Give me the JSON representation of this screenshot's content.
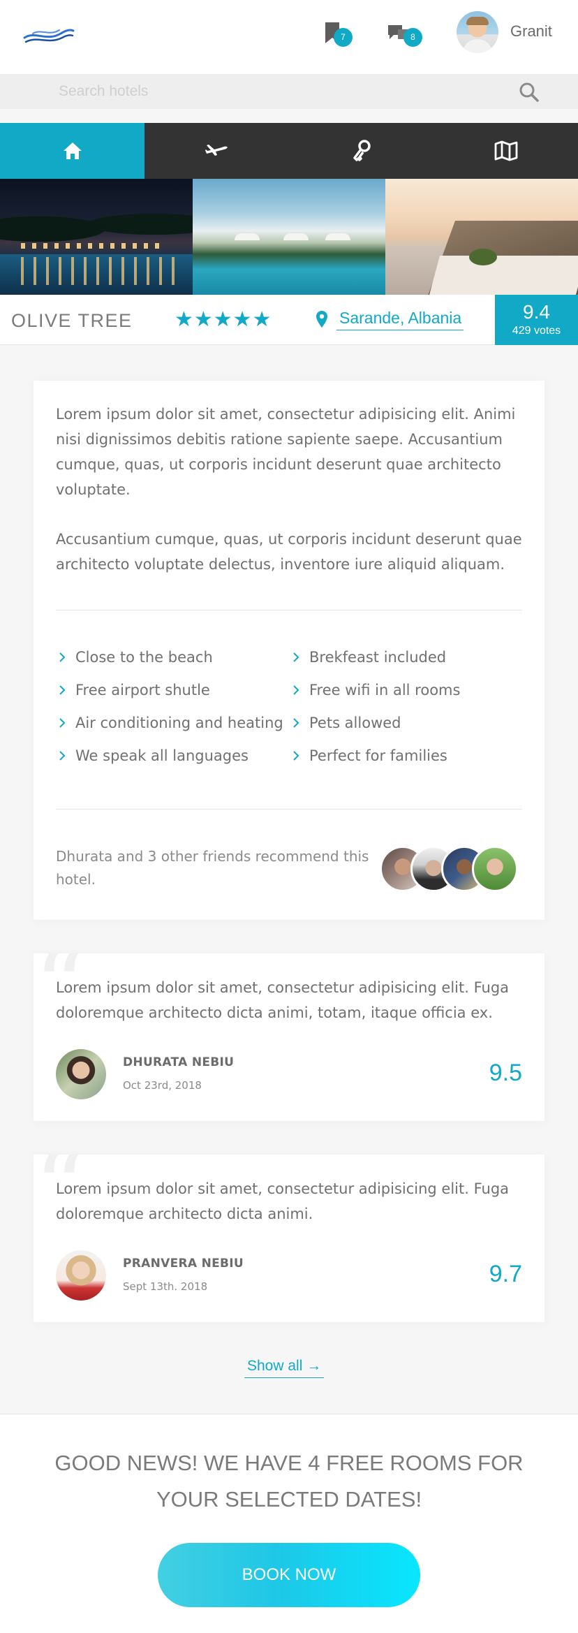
{
  "header": {
    "logo": "wave-logo",
    "bookmarks_count": "7",
    "messages_count": "8",
    "username": "Granit"
  },
  "search": {
    "placeholder": "Search hotels"
  },
  "nav": {
    "tabs": [
      {
        "icon": "home-icon",
        "active": true
      },
      {
        "icon": "airplane-icon",
        "active": false
      },
      {
        "icon": "key-icon",
        "active": false
      },
      {
        "icon": "map-icon",
        "active": false
      }
    ]
  },
  "hotel": {
    "name": "OLIVE TREE",
    "stars": "★★★★★",
    "rating_value": 5,
    "location": "Sarande, Albania",
    "score": "9.4",
    "votes": "429 votes"
  },
  "description": {
    "paragraphs": [
      "Lorem ipsum dolor sit amet, consectetur adipisicing elit. Animi nisi dignissimos debitis ratione sapiente saepe. Accusantium cumque, quas, ut corporis incidunt deserunt quae architecto voluptate.",
      "Accusantium cumque, quas, ut corporis incidunt deserunt quae architecto voluptate delectus, inventore iure aliquid aliquam."
    ],
    "features": [
      "Close to the beach",
      "Brekfeast included",
      "Free airport shutle",
      "Free wifi in all rooms",
      "Air conditioning and heating",
      "Pets allowed",
      "We speak all languages",
      "Perfect for families"
    ],
    "recommend_text": "Dhurata and 3 other friends recommend this hotel."
  },
  "reviews": [
    {
      "text": "Lorem ipsum dolor sit amet, consectetur adipisicing elit. Fuga doloremque architecto dicta animi, totam, itaque officia ex.",
      "name": "DHURATA NEBIU",
      "date": "Oct 23rd, 2018",
      "score": "9.5"
    },
    {
      "text": "Lorem ipsum dolor sit amet, consectetur adipisicing elit. Fuga doloremque architecto dicta animi.",
      "name": "PRANVERA NEBIU",
      "date": "Sept 13th. 2018",
      "score": "9.7"
    }
  ],
  "show_all_label": "Show all →",
  "availability": {
    "message": "GOOD NEWS! WE HAVE 4 FREE ROOMS FOR YOUR SELECTED DATES!",
    "book_label": "BOOK NOW"
  },
  "colors": {
    "accent": "#11a9c6",
    "nav_bg": "#333333",
    "button_gradient_end": "#08e6ff"
  }
}
